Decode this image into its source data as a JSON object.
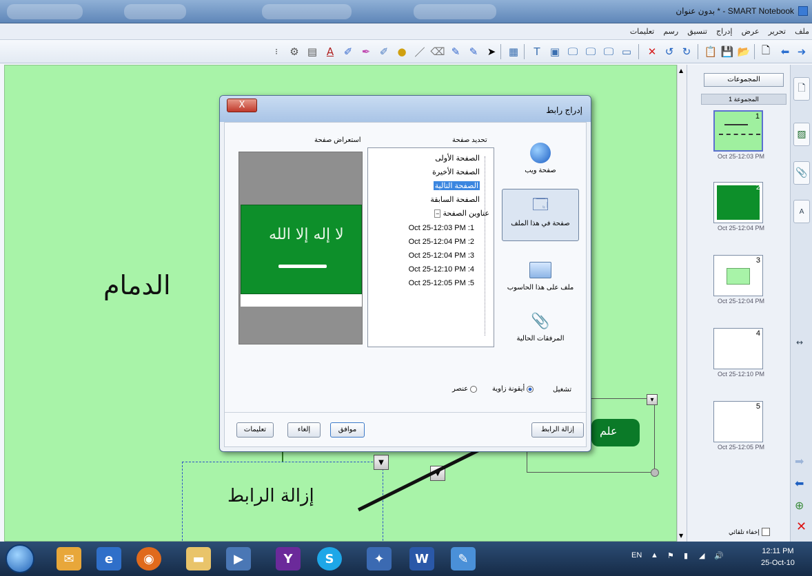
{
  "window": {
    "title": "SMART Notebook - * بدون عنوان"
  },
  "menu": [
    "ملف",
    "تحرير",
    "عرض",
    "إدراج",
    "تنسيق",
    "رسم",
    "تعليمات"
  ],
  "toolbar_icons": [
    "forward-arrow-icon",
    "back-arrow-icon",
    "new-page-icon",
    "open-icon",
    "save-icon",
    "paste-icon",
    "undo-icon",
    "redo-icon",
    "delete-icon",
    "screen-shade-icon",
    "display-icon",
    "monitor-icon",
    "screen-capture-icon",
    "table-icon",
    "text-icon",
    "select-arrow-icon",
    "pen-icon",
    "creative-pen-icon",
    "eraser-icon",
    "line-icon",
    "shape-icon",
    "fill-icon",
    "magic-pen-icon",
    "highlighter-icon",
    "text-a-icon",
    "gallery-icon",
    "properties-icon"
  ],
  "canvas": {
    "dammam_text": "الدمام",
    "remove_link_caption": "إزالة الرابط",
    "green_button_text": "علم"
  },
  "sidebar": {
    "groups_button": "المجموعات",
    "group_label": "المجموعة 1",
    "thumbnails": [
      {
        "num": "1",
        "time": "Oct 25-12:03 PM"
      },
      {
        "num": "2",
        "time": "Oct 25-12:04 PM"
      },
      {
        "num": "3",
        "time": "Oct 25-12:04 PM"
      },
      {
        "num": "4",
        "time": "Oct 25-12:10 PM"
      },
      {
        "num": "5",
        "time": "Oct 25-12:05 PM"
      }
    ],
    "auto_hide": "إخفاء تلقائي"
  },
  "dialog": {
    "title": "إدراج رابط",
    "close": "X",
    "select_page_label": "تحديد صفحة",
    "preview_label": "استعراض صفحة",
    "preview_flag_text": "لا إله إلا الله",
    "choices": [
      "صفحة ويب",
      "صفحة في هذا الملف",
      "ملف على هذا الحاسوب",
      "المرفقات الحالية"
    ],
    "tree": {
      "first": "الصفحة الأولى",
      "last": "الصفحة الأخيرة",
      "next": "الصفحة التالية",
      "previous": "الصفحة السابقة",
      "titles": "عناوين الصفحة",
      "pages": [
        "Oct 25-12:03 PM :1",
        "Oct 25-12:04 PM :2",
        "Oct 25-12:04 PM :3",
        "Oct 25-12:10 PM :4",
        "Oct 25-12:05 PM :5"
      ]
    },
    "launch_label": "تشغيل",
    "launch_corner": "أيقونة زاوية",
    "launch_object": "عنصر",
    "remove_link": "إزالة الرابط",
    "ok": "موافق",
    "cancel": "إلغاء",
    "help": "تعليمات"
  },
  "taskbar": {
    "lang": "EN",
    "time": "12:11 PM",
    "date": "25-Oct-10"
  },
  "colors": {
    "canvas_bg": "#a8f3a8",
    "flag_green": "#0d8f2a",
    "selection": "#3b86e0"
  }
}
